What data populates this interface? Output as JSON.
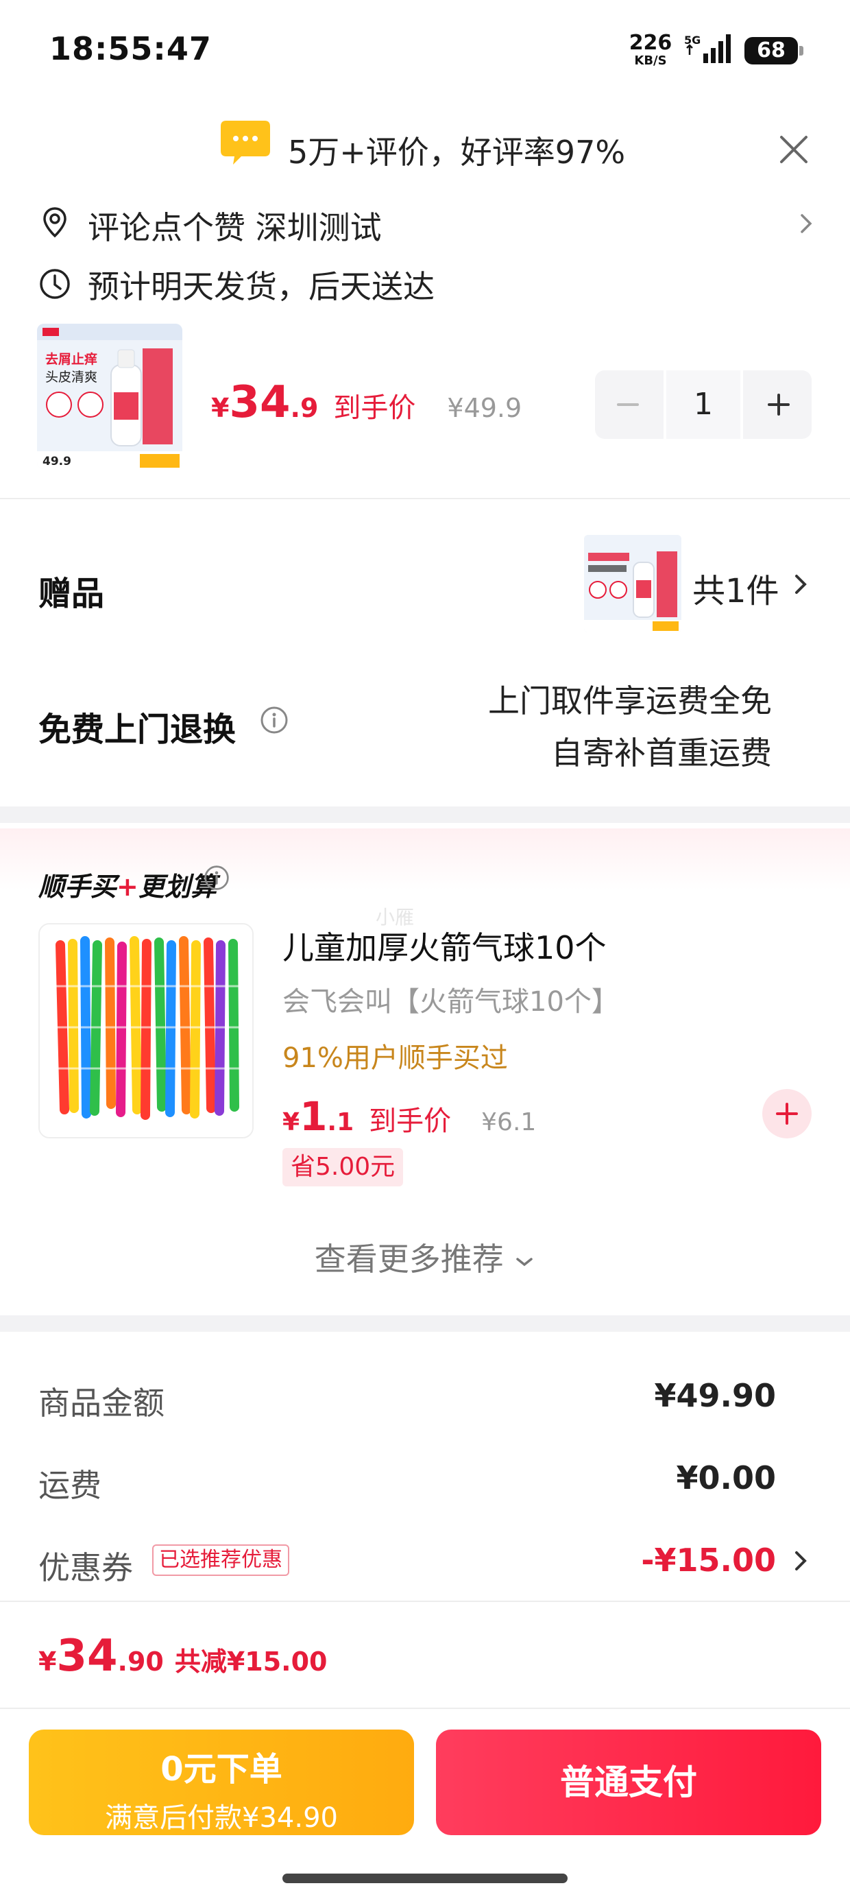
{
  "status_bar": {
    "time": "18:55:47",
    "net_speed": "226",
    "net_unit": "KB/S",
    "network": "5G",
    "battery": "68"
  },
  "header": {
    "banner": "5万+评价，好评率97%",
    "location": "评论点个赞  深圳测试",
    "delivery": "预计明天发货，后天送达"
  },
  "product": {
    "thumb_title": "去屑止痒",
    "thumb_subtitle": "头皮清爽",
    "thumb_price": "49.9",
    "price_yen": "¥",
    "price_int": "34",
    "price_dec": ".9",
    "price_tag": "到手价",
    "price_orig": "¥49.9",
    "quantity": "1"
  },
  "gift": {
    "label": "赠品",
    "count": "共1件"
  },
  "return_service": {
    "label": "免费上门退换",
    "line1": "上门取件享运费全免",
    "line2": "自寄补首重运费"
  },
  "recommend": {
    "title_a": "顺手买",
    "title_b": "更划算",
    "watermark": "小雁",
    "item": {
      "name": "儿童加厚火箭气球10个",
      "sub": "会飞会叫【火箭气球10个】",
      "users": "91%用户顺手买过",
      "price_yen": "¥",
      "price_int": "1",
      "price_dec": ".1",
      "price_tag": "到手价",
      "price_orig": "¥6.1",
      "save": "省5.00元"
    },
    "more": "查看更多推荐"
  },
  "summary": {
    "goods_label": "商品金额",
    "goods_value": "¥49.90",
    "shipping_label": "运费",
    "shipping_value": "¥0.00",
    "coupon_label": "优惠券",
    "coupon_badge": "已选推荐优惠",
    "coupon_value": "-¥15.00"
  },
  "total": {
    "yen": "¥",
    "int": "34",
    "dec": ".90",
    "reduce": "共减¥15.00"
  },
  "buttons": {
    "zero_title": "0元下单",
    "zero_sub": "满意后付款¥34.90",
    "pay": "普通支付"
  },
  "colors": {
    "accent_red": "#e61c3a",
    "gold": "#ffb814",
    "users_text": "#c8861c"
  }
}
